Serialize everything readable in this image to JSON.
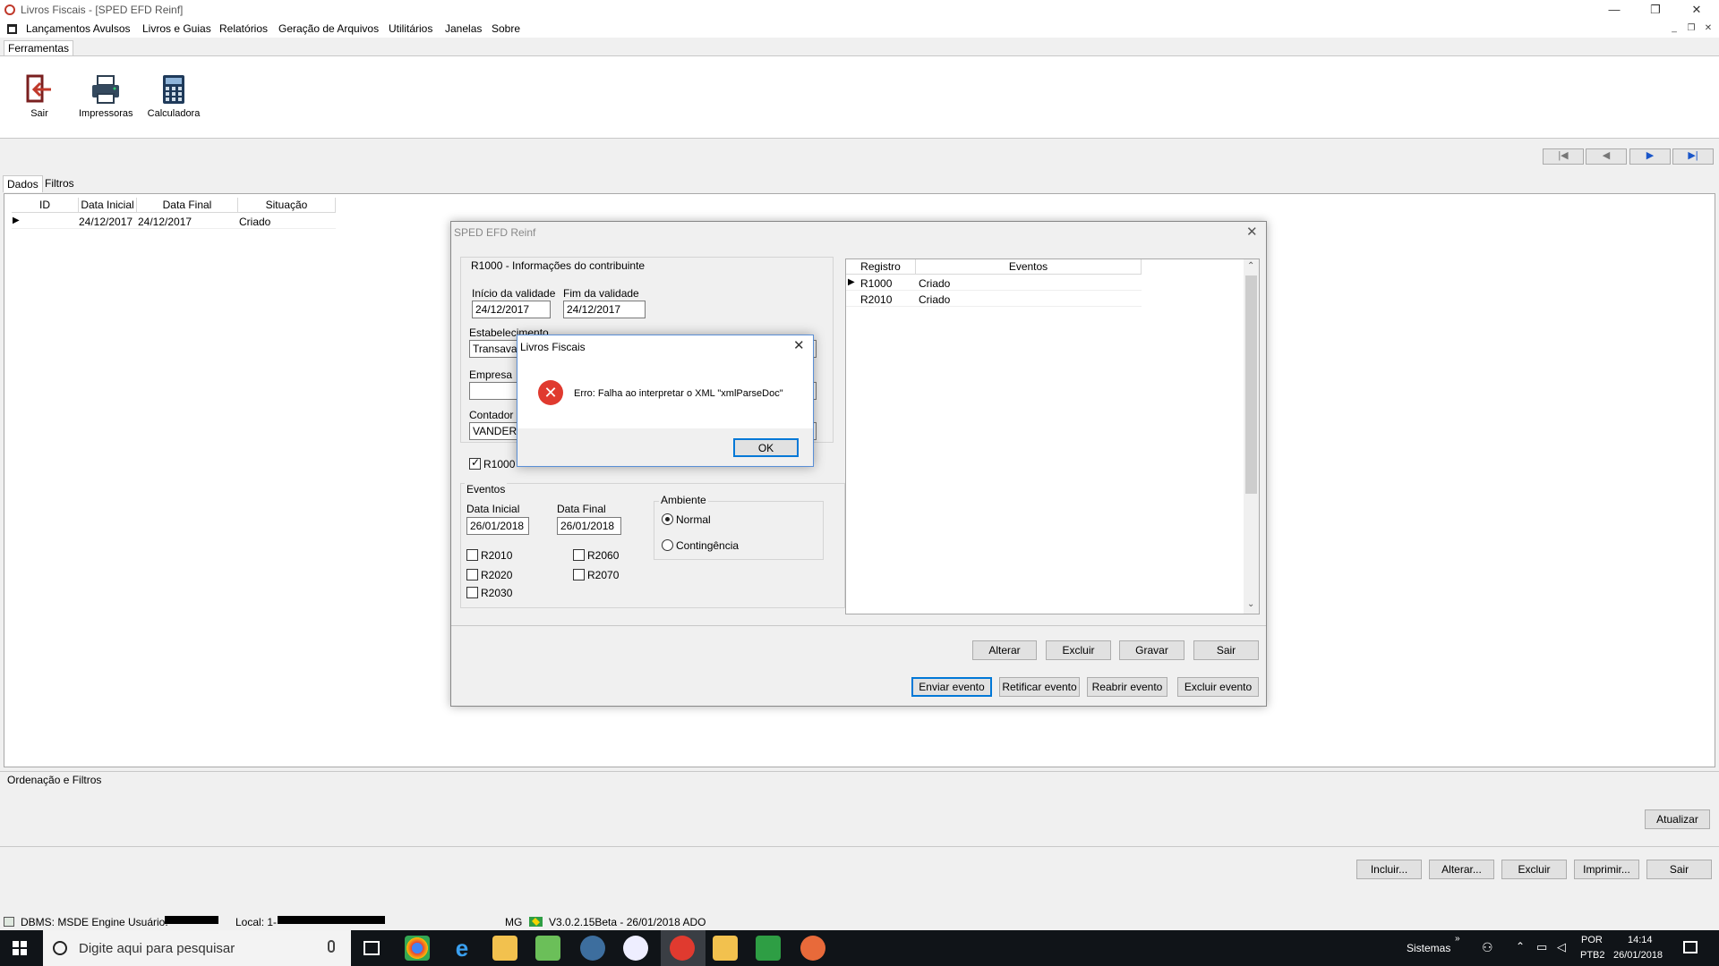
{
  "window": {
    "title": "Livros Fiscais - [SPED EFD Reinf]"
  },
  "menu": {
    "items": [
      "Lançamentos Avulsos",
      "Livros e Guias",
      "Relatórios",
      "Geração de Arquivos",
      "Utilitários",
      "Janelas",
      "Sobre"
    ]
  },
  "ribbon": {
    "tab": "Ferramentas",
    "buttons": [
      {
        "label": "Sair",
        "icon": "exit-door-icon"
      },
      {
        "label": "Impressoras",
        "icon": "printer-icon"
      },
      {
        "label": "Calculadora",
        "icon": "calculator-icon"
      }
    ]
  },
  "nav": {
    "first": "|◀",
    "prev": "◀",
    "next": "▶",
    "last": "▶|"
  },
  "tabs": [
    "Dados",
    "Filtros"
  ],
  "grid": {
    "columns": [
      "ID",
      "Data Inicial",
      "Data Final",
      "Situação"
    ],
    "rows": [
      {
        "id": "",
        "data_inicial": "24/12/2017",
        "data_final": "24/12/2017",
        "situacao": "Criado"
      }
    ]
  },
  "order_panel": {
    "label": "Ordenação e Filtros",
    "refresh": "Atualizar"
  },
  "bottom_buttons": [
    "Incluir...",
    "Alterar...",
    "Excluir",
    "Imprimir...",
    "Sair"
  ],
  "statusbar": {
    "dbms": "DBMS: MSDE Engine",
    "usuario": "Usuário:",
    "local": "Local: 1-",
    "uf": "MG",
    "version": "V3.0.2.15Beta - 26/01/2018  ADO"
  },
  "sped": {
    "title": "SPED EFD Reinf",
    "r1000_group": "R1000 - Informações do contribuinte",
    "inicio_label": "Início da validade",
    "inicio_value": "24/12/2017",
    "fim_label": "Fim da validade",
    "fim_value": "24/12/2017",
    "estab_label": "Estabelecimento",
    "estab_value": "Transavar",
    "empresa_label": "Empresa",
    "empresa_value": "",
    "contador_label": "Contador",
    "contador_value": "VANDER",
    "r1000_check": "R1000",
    "eventos_group": "Eventos",
    "data_inicial_label": "Data Inicial",
    "data_inicial_value": "26/01/2018",
    "data_final_label": "Data Final",
    "data_final_value": "26/01/2018",
    "checks": [
      "R2010",
      "R2020",
      "R2030",
      "R2060",
      "R2070"
    ],
    "ambiente_group": "Ambiente",
    "ambiente_normal": "Normal",
    "ambiente_contingencia": "Contingência",
    "events_grid": {
      "columns": [
        "Registro",
        "Eventos"
      ],
      "rows": [
        {
          "registro": "R1000",
          "eventos": "Criado"
        },
        {
          "registro": "R2010",
          "eventos": "Criado"
        }
      ]
    },
    "buttons_row1": [
      "Alterar",
      "Excluir",
      "Gravar",
      "Sair"
    ],
    "buttons_row2": [
      "Enviar evento",
      "Retificar evento",
      "Reabrir evento",
      "Excluir evento"
    ]
  },
  "msgbox": {
    "title": "Livros Fiscais",
    "message": "Erro: Falha ao interpretar o XML \"xmlParseDoc\"",
    "ok": "OK"
  },
  "taskbar": {
    "search_placeholder": "Digite aqui para pesquisar",
    "sistemas": "Sistemas",
    "lang1": "POR",
    "lang2": "PTB2",
    "time": "14:14",
    "date": "26/01/2018"
  },
  "colors": {
    "accent": "#0078d7",
    "error": "#e03a2f",
    "taskbar": "#101418"
  }
}
